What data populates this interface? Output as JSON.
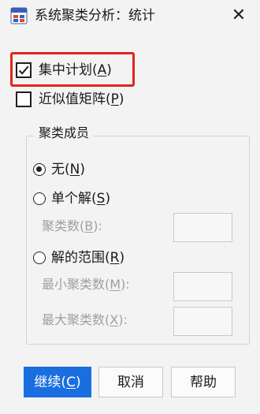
{
  "window": {
    "title": "系统聚类分析：统计",
    "close_glyph": "✕",
    "icon": "cluster-analysis-icon"
  },
  "options": {
    "agglomeration_schedule": {
      "text": "集中计划(",
      "mnemonic": "A",
      "close": ")",
      "checked": true
    },
    "proximity_matrix": {
      "text": "近似值矩阵(",
      "mnemonic": "P",
      "close": ")",
      "checked": false
    }
  },
  "cluster_membership": {
    "group_title": "聚类成员",
    "none": {
      "text": "无(",
      "mnemonic": "N",
      "close": ")",
      "selected": true
    },
    "single_solution": {
      "text": "单个解(",
      "mnemonic": "S",
      "close": ")",
      "selected": false
    },
    "num_clusters": {
      "text": "聚类数(",
      "mnemonic": "B",
      "close": "):",
      "value": ""
    },
    "range_of_solutions": {
      "text": "解的范围(",
      "mnemonic": "R",
      "close": ")",
      "selected": false
    },
    "min_clusters": {
      "text": "最小聚类数(",
      "mnemonic": "M",
      "close": "):",
      "value": ""
    },
    "max_clusters": {
      "text": "最大聚类数(",
      "mnemonic": "X",
      "close": "):",
      "value": ""
    }
  },
  "buttons": {
    "continue": {
      "text": "继续(",
      "mnemonic": "C",
      "close": ")"
    },
    "cancel": "取消",
    "help": "帮助"
  },
  "colors": {
    "highlight": "#e0251b",
    "primary_button": "#1a6fe0"
  }
}
